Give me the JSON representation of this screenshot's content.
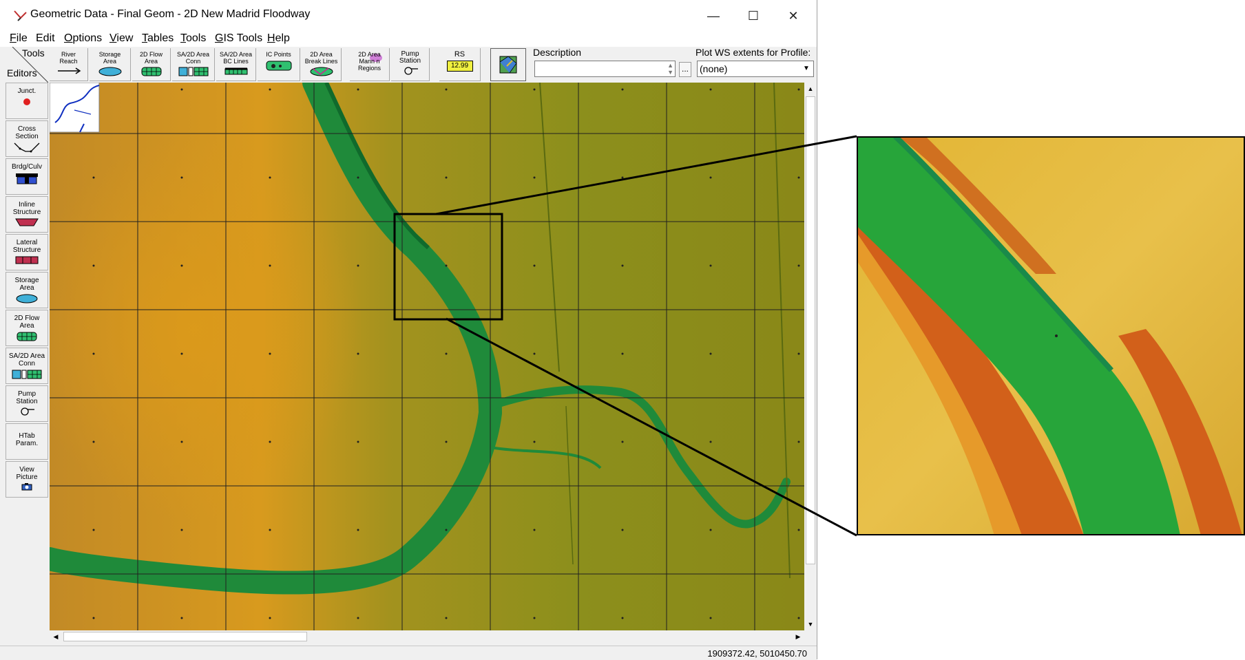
{
  "window": {
    "title": "Geometric Data - Final Geom - 2D New Madrid Floodway",
    "controls": {
      "minimize": "—",
      "maximize": "☐",
      "close": "✕"
    }
  },
  "menu": [
    {
      "accel": "F",
      "rest": "ile"
    },
    {
      "accel": "",
      "rest": "Edit"
    },
    {
      "accel": "O",
      "rest": "ptions"
    },
    {
      "accel": "V",
      "rest": "iew"
    },
    {
      "accel": "T",
      "rest": "ables"
    },
    {
      "accel": "T",
      "rest": "ools"
    },
    {
      "accel": "G",
      "rest": "IS Tools"
    },
    {
      "accel": "H",
      "rest": "elp"
    }
  ],
  "toolbar": {
    "tools_label": "Tools",
    "editors_label": "Editors",
    "buttons": [
      {
        "label": "River\nReach",
        "icon": "river-reach-icon"
      },
      {
        "label": "Storage\nArea",
        "icon": "storage-area-icon"
      },
      {
        "label": "2D Flow\nArea",
        "icon": "2d-flow-area-icon"
      },
      {
        "label": "SA/2D Area\nConn",
        "icon": "sa-2d-conn-icon"
      },
      {
        "label": "SA/2D Area\nBC Lines",
        "icon": "bc-lines-icon"
      },
      {
        "label": "IC Points",
        "icon": "ic-points-icon"
      },
      {
        "label": "2D Area\nBreak Lines",
        "icon": "break-lines-icon"
      },
      {
        "label": "2D Area\nMann n\nRegions",
        "icon": "mann-n-icon"
      },
      {
        "label": "Pump\nStation",
        "icon": "pump-station-icon"
      },
      {
        "label": "RS",
        "icon": "rs-icon"
      }
    ],
    "rs_value": "12.99",
    "description_label": "Description",
    "description_value": "",
    "description_browse": "...",
    "plot_ws_label": "Plot WS extents for Profile:",
    "plot_ws_value": "(none)"
  },
  "editors": [
    {
      "label": "Junct.",
      "icon": "junction-icon"
    },
    {
      "label": "Cross\nSection",
      "icon": "cross-section-icon"
    },
    {
      "label": "Brdg/Culv",
      "icon": "bridge-culvert-icon"
    },
    {
      "label": "Inline\nStructure",
      "icon": "inline-structure-icon"
    },
    {
      "label": "Lateral\nStructure",
      "icon": "lateral-structure-icon"
    },
    {
      "label": "Storage\nArea",
      "icon": "storage-area-icon"
    },
    {
      "label": "2D Flow\nArea",
      "icon": "2d-flow-area-icon"
    },
    {
      "label": "SA/2D Area\nConn",
      "icon": "sa-2d-conn-icon"
    },
    {
      "label": "Pump\nStation",
      "icon": "pump-station-icon"
    },
    {
      "label": "HTab\nParam.",
      "icon": ""
    },
    {
      "label": "View\nPicture",
      "icon": "camera-icon"
    }
  ],
  "status": {
    "coordinates": "1909372.42, 5010450.70"
  },
  "colors": {
    "terrain_high": "#c8901c",
    "terrain_low": "#8a9a1e",
    "channel": "#1f8a3a",
    "channel_dark": "#106a2c",
    "zoom_channel": "#27a53a",
    "zoom_bank": "#d2601a",
    "zoom_light": "#e8b830"
  }
}
